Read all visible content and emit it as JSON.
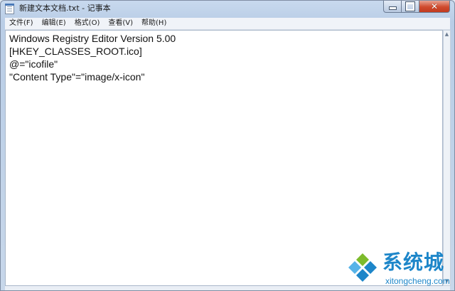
{
  "window": {
    "title": "新建文本文档.txt - 记事本"
  },
  "controls": {
    "minimize_icon": "minimize-icon",
    "maximize_icon": "maximize-icon",
    "close_icon": "close-icon",
    "close_glyph": "✕"
  },
  "menu": {
    "items": [
      {
        "label": "文件(F)"
      },
      {
        "label": "编辑(E)"
      },
      {
        "label": "格式(O)"
      },
      {
        "label": "查看(V)"
      },
      {
        "label": "帮助(H)"
      }
    ]
  },
  "editor": {
    "lines": [
      "Windows Registry Editor Version 5.00",
      "[HKEY_CLASSES_ROOT.ico]",
      "@=\"icofile\"",
      "\"Content Type\"=\"image/x-icon\""
    ]
  },
  "watermark": {
    "brand": "系统城",
    "url": "xitongcheng.com",
    "colors": {
      "blue": "#1d86c9",
      "green": "#7dbb2c",
      "light_blue": "#56b3e8"
    }
  }
}
